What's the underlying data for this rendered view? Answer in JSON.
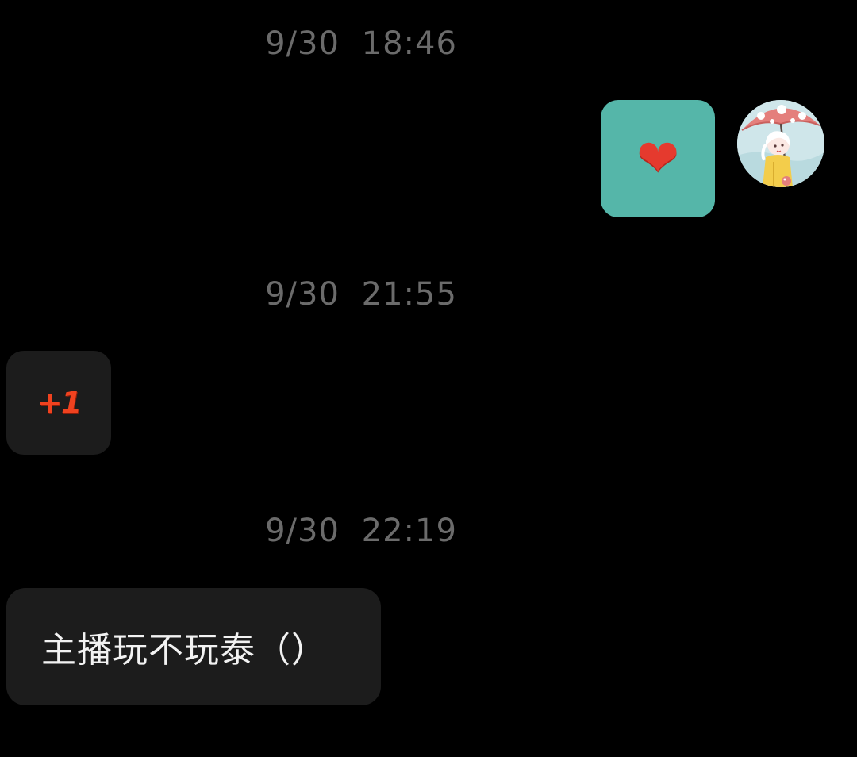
{
  "messages": [
    {
      "timestamp": "9/30  18:46",
      "direction": "sent",
      "type": "sticker",
      "sticker": "heart-icon",
      "bubble_color": "#55b6a9"
    },
    {
      "timestamp": "9/30  21:55",
      "direction": "received",
      "type": "sticker",
      "sticker_text": "+1",
      "bubble_color": "#1c1c1c"
    },
    {
      "timestamp": "9/30  22:19",
      "direction": "received",
      "type": "text",
      "text": "主播玩不玩泰（）",
      "bubble_color": "#1c1c1c"
    }
  ],
  "colors": {
    "background": "#000000",
    "timestamp_text": "#6b6b6b",
    "message_text": "#f2f2f2",
    "heart": "#e53a2e",
    "plus_one": "#f0421f"
  }
}
